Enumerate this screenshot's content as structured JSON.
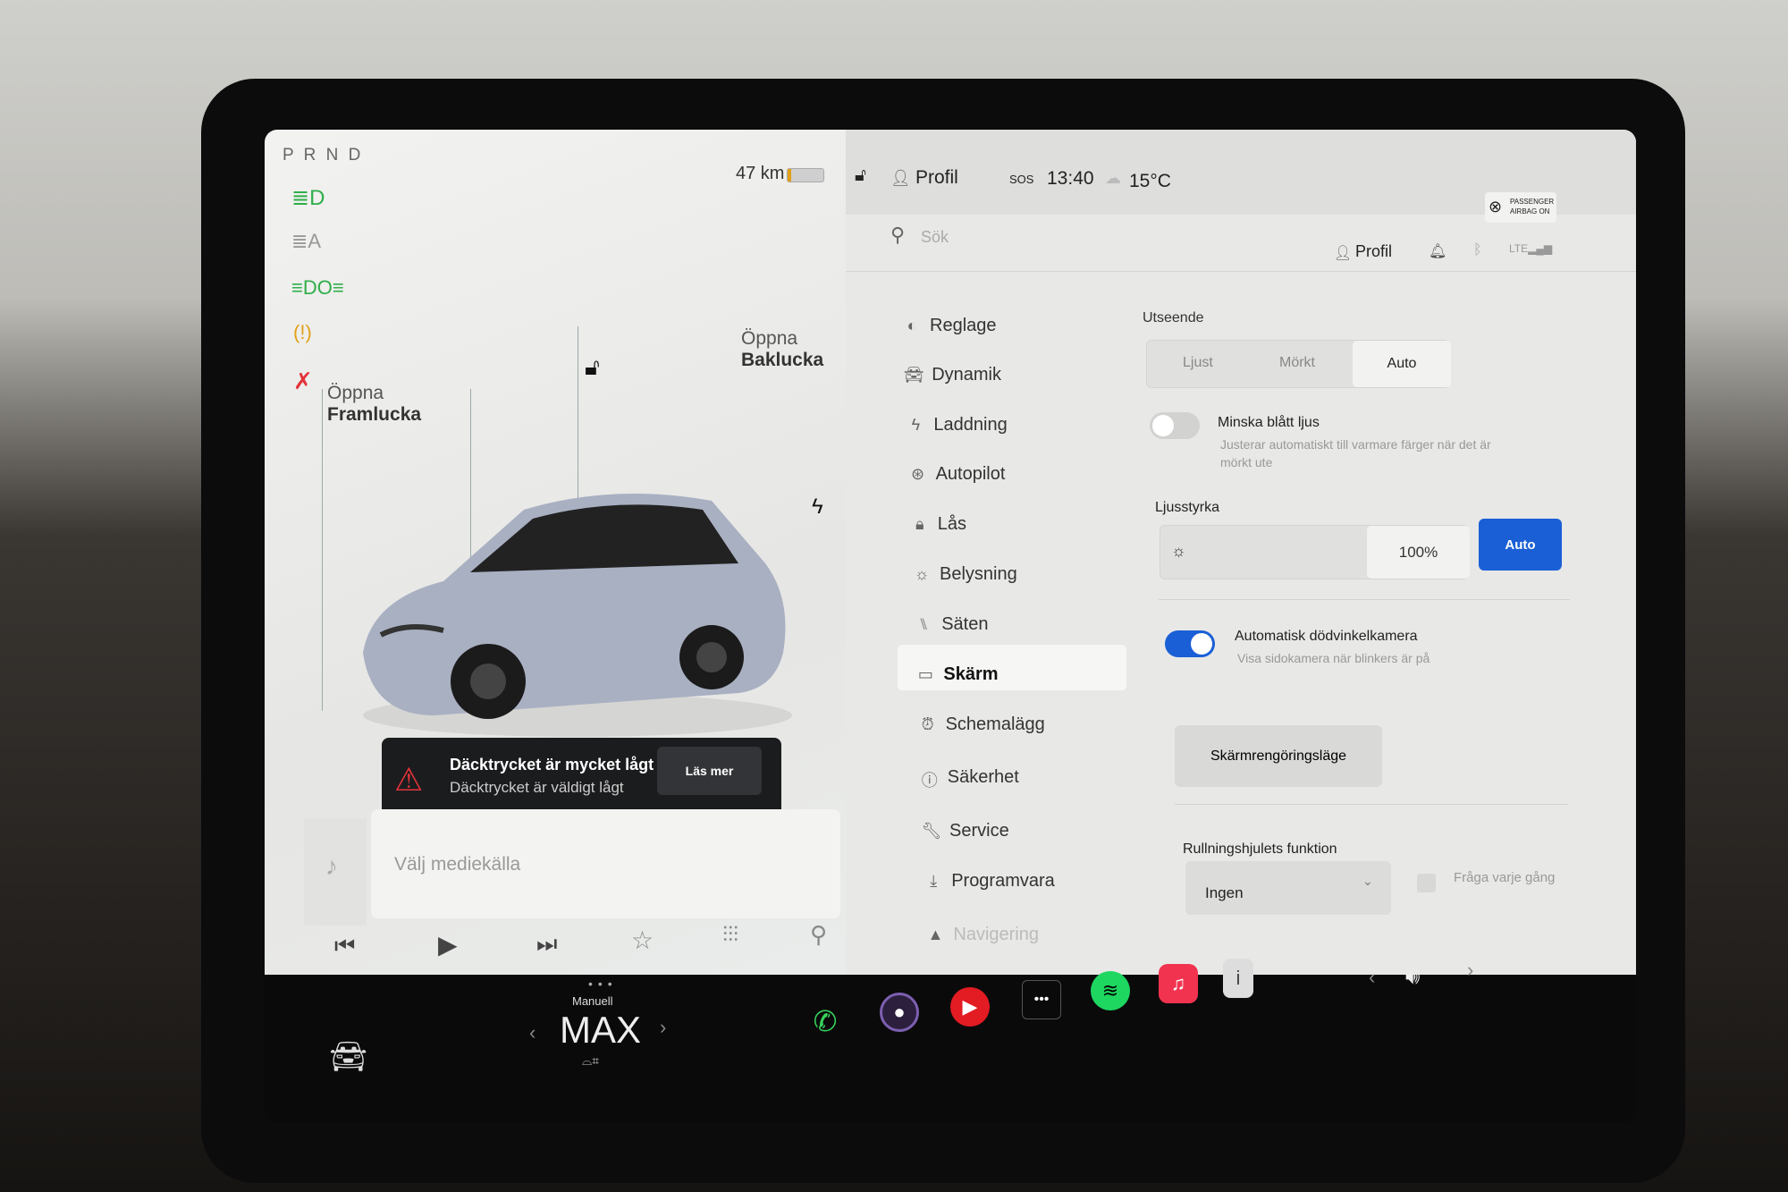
{
  "status_bar": {
    "gear": "P R N D",
    "range": "47 km",
    "profile": "Profil",
    "sos": "SOS",
    "time": "13:40",
    "temperature": "15°C",
    "airbag_line1": "PASSENGER",
    "airbag_line2": "AIRBAG ON"
  },
  "car_panel": {
    "frunk_label_1": "Öppna",
    "frunk_label_2": "Framlucka",
    "trunk_label_1": "Öppna",
    "trunk_label_2": "Baklucka"
  },
  "alert": {
    "title": "Däcktrycket är mycket lågt",
    "subtitle": "Däcktrycket är väldigt lågt",
    "button": "Läs mer",
    "color": "#e3343a"
  },
  "media": {
    "placeholder": "Välj mediekälla"
  },
  "settings": {
    "search_placeholder": "Sök",
    "profile": "Profil",
    "menu": [
      {
        "label": "Reglage",
        "icon": "toggle-icon"
      },
      {
        "label": "Dynamik",
        "icon": "car-icon"
      },
      {
        "label": "Laddning",
        "icon": "bolt-icon"
      },
      {
        "label": "Autopilot",
        "icon": "steering-wheel-icon"
      },
      {
        "label": "Lås",
        "icon": "lock-icon"
      },
      {
        "label": "Belysning",
        "icon": "sun-icon"
      },
      {
        "label": "Säten",
        "icon": "seat-icon"
      },
      {
        "label": "Skärm",
        "icon": "display-icon",
        "selected": true
      },
      {
        "label": "Schemalägg",
        "icon": "alarm-clock-icon"
      },
      {
        "label": "Säkerhet",
        "icon": "info-circle-icon"
      },
      {
        "label": "Service",
        "icon": "wrench-icon"
      },
      {
        "label": "Programvara",
        "icon": "download-icon"
      },
      {
        "label": "Navigering",
        "icon": "navigation-icon"
      }
    ],
    "appearance": {
      "title": "Utseende",
      "options": [
        "Ljust",
        "Mörkt",
        "Auto"
      ],
      "selected": "Auto"
    },
    "blue_light": {
      "label": "Minska blått ljus",
      "description_1": "Justerar automatiskt till varmare färger när det är",
      "description_2": "mörkt ute",
      "enabled": false
    },
    "brightness": {
      "title": "Ljusstyrka",
      "value": "100%",
      "level_percent": 100,
      "auto_label": "Auto"
    },
    "blind_spot": {
      "label": "Automatisk dödvinkelkamera",
      "description": "Visa sidokamera när blinkers är på",
      "enabled": true
    },
    "clean_mode_button": "Skärmrengöringsläge",
    "scroll_wheel": {
      "title": "Rullningshjulets funktion",
      "selected": "Ingen",
      "ask_label": "Fråga varje gång",
      "ask_checked": false
    }
  },
  "taskbar": {
    "climate_mode": "Manuell",
    "fan": "MAX",
    "accent": "#1a5fd6"
  }
}
